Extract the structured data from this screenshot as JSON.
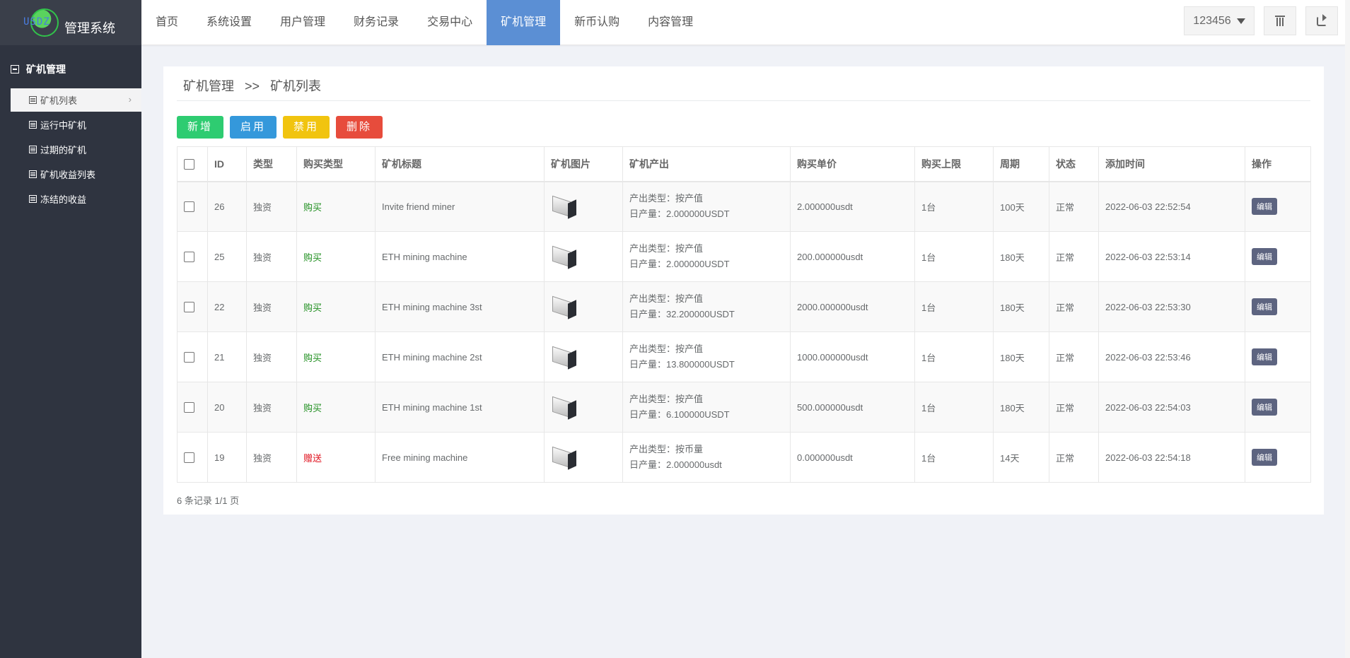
{
  "logo": {
    "badge": "USDZ",
    "title": "管理系统"
  },
  "sidebar": {
    "group_title": "矿机管理",
    "items": [
      {
        "label": "矿机列表",
        "active": true
      },
      {
        "label": "运行中矿机",
        "active": false
      },
      {
        "label": "过期的矿机",
        "active": false
      },
      {
        "label": "矿机收益列表",
        "active": false
      },
      {
        "label": "冻结的收益",
        "active": false
      }
    ]
  },
  "topnav": {
    "items": [
      "首页",
      "系统设置",
      "用户管理",
      "财务记录",
      "交易中心",
      "矿机管理",
      "新币认购",
      "内容管理"
    ],
    "active_index": 5,
    "user_label": "123456"
  },
  "breadcrumb": {
    "parent": "矿机管理",
    "separator": ">>",
    "current": "矿机列表"
  },
  "actions": [
    {
      "label": "新增",
      "color": "#2ecc71"
    },
    {
      "label": "启用",
      "color": "#3498db"
    },
    {
      "label": "禁用",
      "color": "#f1c40f"
    },
    {
      "label": "删除",
      "color": "#e74c3c"
    }
  ],
  "table": {
    "headers": [
      "ID",
      "类型",
      "购买类型",
      "矿机标题",
      "矿机图片",
      "矿机产出",
      "购买单价",
      "购买上限",
      "周期",
      "状态",
      "添加时间",
      "操作"
    ],
    "rows": [
      {
        "id": "26",
        "type": "独资",
        "buy_type": "购买",
        "buy_kind": "buy",
        "title": "Invite friend miner",
        "output_type": "产出类型：按产值",
        "daily": "日产量：2.000000USDT",
        "price": "2.000000usdt",
        "limit": "1台",
        "period": "100天",
        "status": "正常",
        "time": "2022-06-03 22:52:54",
        "action": "编辑"
      },
      {
        "id": "25",
        "type": "独资",
        "buy_type": "购买",
        "buy_kind": "buy",
        "title": "ETH mining machine",
        "output_type": "产出类型：按产值",
        "daily": "日产量：2.000000USDT",
        "price": "200.000000usdt",
        "limit": "1台",
        "period": "180天",
        "status": "正常",
        "time": "2022-06-03 22:53:14",
        "action": "编辑"
      },
      {
        "id": "22",
        "type": "独资",
        "buy_type": "购买",
        "buy_kind": "buy",
        "title": "ETH mining machine 3st",
        "output_type": "产出类型：按产值",
        "daily": "日产量：32.200000USDT",
        "price": "2000.000000usdt",
        "limit": "1台",
        "period": "180天",
        "status": "正常",
        "time": "2022-06-03 22:53:30",
        "action": "编辑"
      },
      {
        "id": "21",
        "type": "独资",
        "buy_type": "购买",
        "buy_kind": "buy",
        "title": "ETH mining machine 2st",
        "output_type": "产出类型：按产值",
        "daily": "日产量：13.800000USDT",
        "price": "1000.000000usdt",
        "limit": "1台",
        "period": "180天",
        "status": "正常",
        "time": "2022-06-03 22:53:46",
        "action": "编辑"
      },
      {
        "id": "20",
        "type": "独资",
        "buy_type": "购买",
        "buy_kind": "buy",
        "title": "ETH mining machine 1st",
        "output_type": "产出类型：按产值",
        "daily": "日产量：6.100000USDT",
        "price": "500.000000usdt",
        "limit": "1台",
        "period": "180天",
        "status": "正常",
        "time": "2022-06-03 22:54:03",
        "action": "编辑"
      },
      {
        "id": "19",
        "type": "独资",
        "buy_type": "赠送",
        "buy_kind": "gift",
        "title": "Free mining machine",
        "output_type": "产出类型：按币量",
        "daily": "日产量：2.000000usdt",
        "price": "0.000000usdt",
        "limit": "1台",
        "period": "14天",
        "status": "正常",
        "time": "2022-06-03 22:54:18",
        "action": "编辑"
      }
    ]
  },
  "footer": {
    "count_text": "6 条记录 1/1 页"
  }
}
